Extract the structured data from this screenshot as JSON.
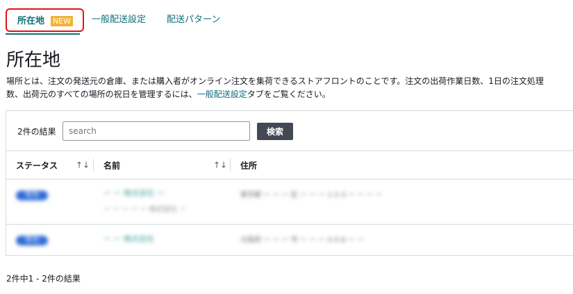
{
  "tabs": [
    {
      "label": "所在地",
      "badge": "NEW"
    },
    {
      "label": "一般配送設定"
    },
    {
      "label": "配送パターン"
    }
  ],
  "page": {
    "title": "所在地",
    "description_prefix": "場所とは、注文の発送元の倉庫、または購入者がオンライン注文を集荷できるストアフロントのことです。注文の出荷作業日数、1日の注文処理数、出荷元のすべての場所の祝日を管理するには、",
    "description_link": "一般配送設定",
    "description_suffix": "タブをご覧ください。"
  },
  "table": {
    "result_count": "2件の結果",
    "search_placeholder": "search",
    "search_button": "検索",
    "columns": [
      "ステータス",
      "名前",
      "住所"
    ],
    "sort_icon": "↑↓",
    "rows": [
      {
        "status": "有効",
        "name": "ー ー 株式会社 ー",
        "subname": "ー ー ー ー ー 株式会社 ー",
        "address": "東京都 ー ー ー 区 ー ー ー 1-2-3 ー ー ー ー"
      },
      {
        "status": "有効",
        "name": "ー ー 株式会社",
        "subname": "",
        "address": "大阪府 ー ー ー 市 ー ー ー 4-5-6 ー ー"
      }
    ]
  },
  "footer": {
    "summary": "2件中1 - 2件の結果"
  },
  "colors": {
    "accent": "#0f6e7a",
    "highlight": "#e0121c",
    "badge": "#f4b234",
    "button": "#424954"
  }
}
